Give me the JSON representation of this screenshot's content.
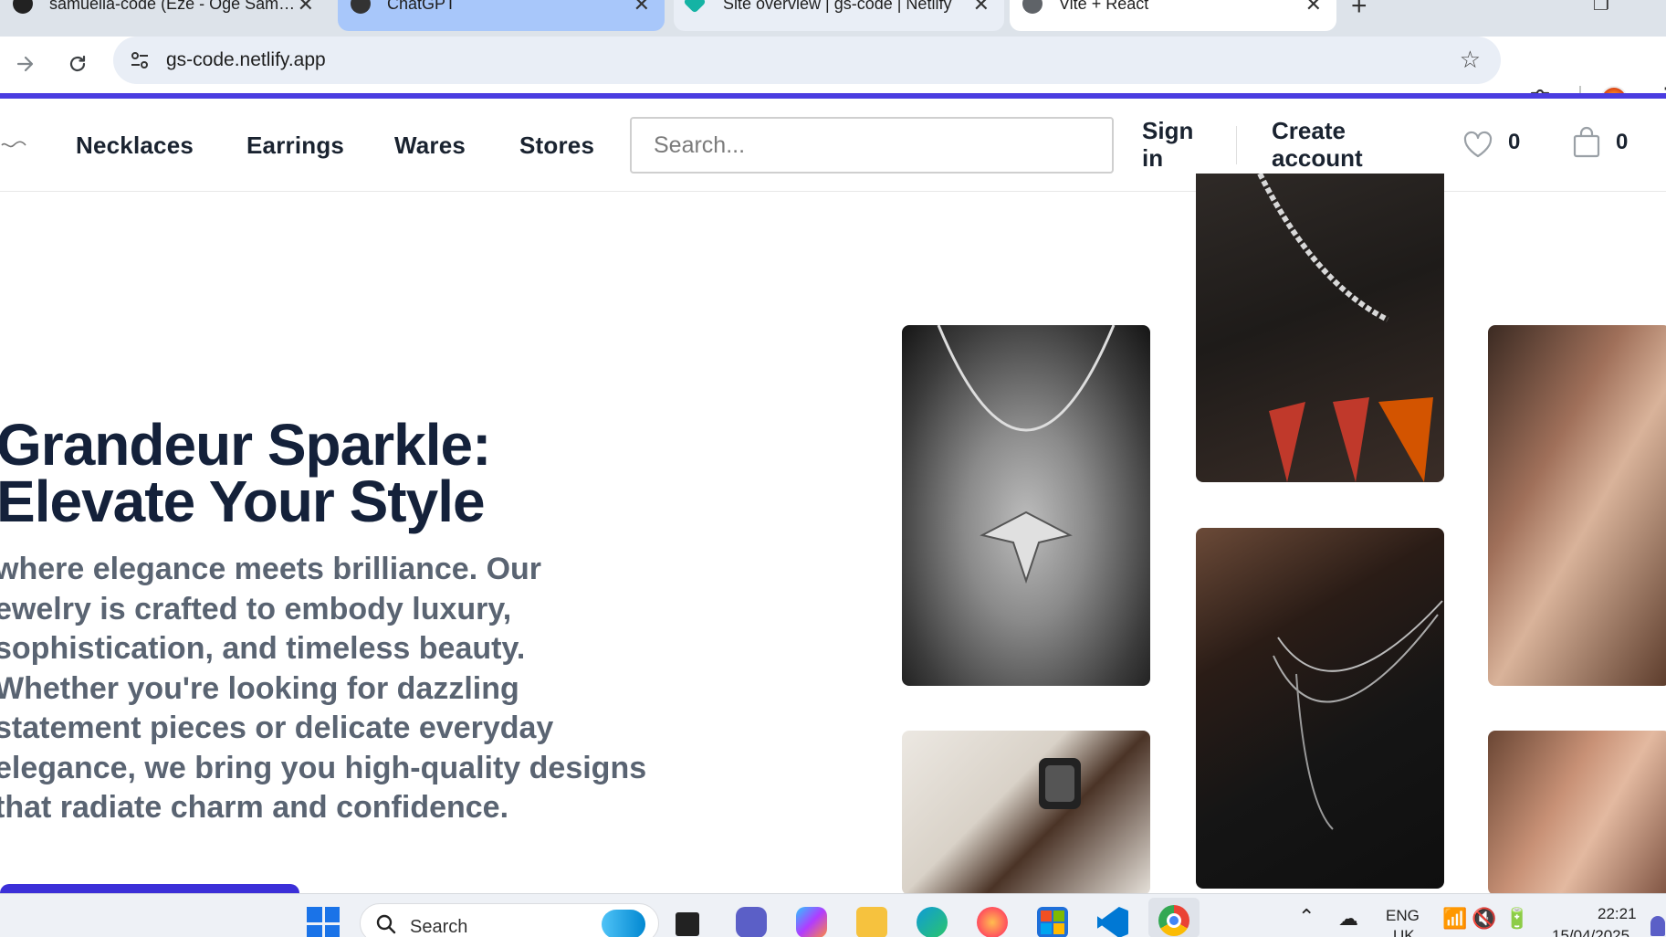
{
  "browser": {
    "tabs": [
      {
        "title": "samuella-code (Eze - Oge Sam…",
        "active": false
      },
      {
        "title": "ChatGPT",
        "active": false
      },
      {
        "title": "Site overview | gs-code | Netlify",
        "active": false
      },
      {
        "title": "Vite + React",
        "active": true
      }
    ],
    "new_tab": "+",
    "close_glyph": "✕",
    "url": "gs-code.netlify.app",
    "icons": [
      "back-icon",
      "forward-icon",
      "reload-icon",
      "site-settings-icon",
      "bookmark-star-icon",
      "extensions-icon",
      "profile-avatar",
      "menu-icon"
    ]
  },
  "site": {
    "accent_color": "#4a3ce0",
    "nav": {
      "links": [
        "Necklaces",
        "Earrings",
        "Wares",
        "Stores"
      ],
      "search_placeholder": "Search...",
      "sign_in_line1": "Sign",
      "sign_in_line2": "in",
      "create_line1": "Create",
      "create_line2": "account",
      "wishlist_count": "0",
      "cart_count": "0"
    },
    "hero": {
      "title_line1": "Grandeur Sparkle:",
      "title_line2": "Elevate Your Style",
      "body_lines": [
        "where elegance meets brilliance. Our",
        "ewelry is crafted to embody luxury,",
        "sophistication, and timeless beauty.",
        "Whether you're looking for dazzling",
        "statement pieces or delicate everyday",
        "elegance, we bring you high-quality designs",
        "that radiate charm and confidence."
      ]
    },
    "gallery": [
      "necklace-pendant-photo",
      "chain-on-shirt-photo",
      "earring-model-photo",
      "layered-chains-photo",
      "watch-and-rings-photo",
      "model-with-rings-photo"
    ]
  },
  "taskbar": {
    "search_label": "Search",
    "language_line1": "ENG",
    "language_line2": "UK",
    "time": "22:21",
    "date": "15/04/2025"
  }
}
